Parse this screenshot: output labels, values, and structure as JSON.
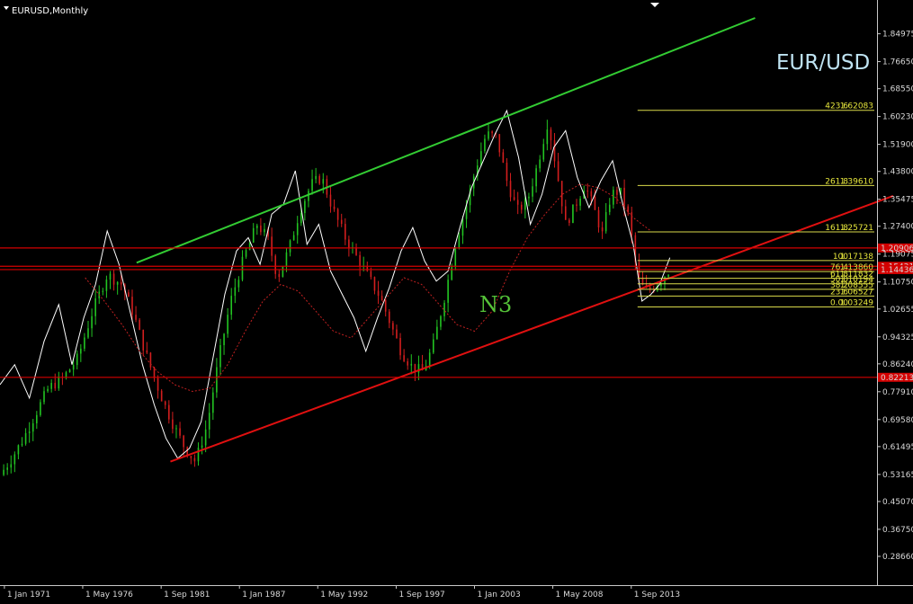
{
  "chart_title": "EURUSD,Monthly",
  "symbol_label": "EUR/USD",
  "wave_label": "N3",
  "colors": {
    "background": "#000000",
    "axis": "#c8c8c8",
    "channel_upper": "#33cc33",
    "channel_lower": "#e01010",
    "fib": "#d9d94a",
    "bull_candle": "#22c422",
    "bear_candle": "#d21e1e",
    "overlay_line": "#ffffff",
    "dotted_line": "#c02020",
    "level_badge": "#d40000"
  },
  "chart_data": {
    "type": "line",
    "ylim": [
      0.2866,
      1.897
    ],
    "y_ticks": [
      "1.84975",
      "1.76650",
      "1.68550",
      "1.60230",
      "1.51900",
      "1.43800",
      "1.35475",
      "1.27400",
      "1.19075",
      "1.10750",
      "1.02655",
      "0.94325",
      "0.86240",
      "0.77910",
      "0.69580",
      "0.61495",
      "0.53165",
      "0.45070",
      "0.36750",
      "0.28660"
    ],
    "x_ticks": [
      "1 Jan 1971",
      "1 May 1976",
      "1 Sep 1981",
      "1 Jan 1987",
      "1 May 1992",
      "1 Sep 1997",
      "1 Jan 2003",
      "1 May 2008",
      "1 Sep 2013"
    ],
    "x_tick_dates": [
      1971.0,
      1976.33,
      1981.67,
      1987.0,
      1992.33,
      1997.67,
      2003.0,
      2008.33,
      2013.67
    ],
    "xlim": [
      1970.7,
      2030.4
    ],
    "series": [
      {
        "values_y": [
          0.53,
          0.58,
          0.64,
          0.72,
          0.79,
          0.82,
          0.88,
          1.02,
          1.13,
          1.1,
          1.01,
          0.91,
          0.82,
          0.74,
          0.67,
          0.61,
          0.57,
          0.68,
          0.88,
          1.05,
          1.18,
          1.28,
          1.24,
          1.12,
          1.21,
          1.32,
          1.4,
          1.42,
          1.32,
          1.24,
          1.18,
          1.12,
          1.06,
          0.98,
          0.9,
          0.85,
          0.84,
          0.92,
          1.07,
          1.22,
          1.33,
          1.45,
          1.55,
          1.54,
          1.41,
          1.32,
          1.35,
          1.46,
          1.59,
          1.44,
          1.28,
          1.33,
          1.4,
          1.33,
          1.25,
          1.37,
          1.38,
          1.3,
          1.12,
          1.08,
          1.09,
          1.11,
          1.13,
          1.15
        ],
        "values_x": [
          1970.7,
          1971.5,
          1972.3,
          1973.2,
          1974.0,
          1975.0,
          1976.0,
          1977.0,
          1978.0,
          1979.0,
          1979.8,
          1980.5,
          1981.2,
          1981.9,
          1982.6,
          1983.3,
          1984.0,
          1984.8,
          1985.6,
          1986.4,
          1987.3,
          1988.2,
          1988.9,
          1989.6,
          1990.4,
          1991.1,
          1991.9,
          1992.6,
          1993.4,
          1994.2,
          1995.0,
          1995.8,
          1996.6,
          1997.3,
          1998.0,
          1998.8,
          1999.5,
          2000.2,
          2001.0,
          2001.7,
          2002.4,
          2003.1,
          2003.8,
          2004.5,
          2005.2,
          2005.9,
          2006.6,
          2007.3,
          2008.0,
          2008.6,
          2009.2,
          2009.8,
          2010.5,
          2011.1,
          2011.7,
          2012.3,
          2012.9,
          2013.5,
          2014.1,
          2014.6,
          2015.1,
          2015.6,
          2016.0,
          2016.4
        ]
      },
      {
        "values_y": [
          0.8,
          0.86,
          0.76,
          0.93,
          1.04,
          0.86,
          1.0,
          1.1,
          1.26,
          1.16,
          1.01,
          0.86,
          0.74,
          0.64,
          0.58,
          0.61,
          0.69,
          0.88,
          1.07,
          1.2,
          1.24,
          1.16,
          1.31,
          1.34,
          1.44,
          1.22,
          1.28,
          1.14,
          1.07,
          1.0,
          0.9,
          1.0,
          1.09,
          1.2,
          1.27,
          1.17,
          1.11,
          1.14,
          1.27,
          1.39,
          1.47,
          1.55,
          1.62,
          1.48,
          1.28,
          1.37,
          1.51,
          1.56,
          1.42,
          1.33,
          1.41,
          1.47,
          1.32,
          1.22,
          1.05,
          1.07,
          1.1,
          1.18
        ],
        "values_x": [
          1970.7,
          1971.7,
          1972.7,
          1973.7,
          1974.7,
          1975.6,
          1976.4,
          1977.2,
          1978.0,
          1978.8,
          1979.6,
          1980.4,
          1981.2,
          1982.0,
          1982.8,
          1983.6,
          1984.4,
          1985.2,
          1986.0,
          1986.8,
          1987.6,
          1988.4,
          1989.2,
          1990.0,
          1990.8,
          1991.6,
          1992.4,
          1993.2,
          1994.0,
          1994.8,
          1995.6,
          1996.4,
          1997.2,
          1998.0,
          1998.8,
          1999.6,
          2000.4,
          2001.2,
          2002.0,
          2002.8,
          2003.6,
          2004.4,
          2005.2,
          2006.0,
          2006.8,
          2007.6,
          2008.4,
          2009.2,
          2010.0,
          2010.8,
          2011.6,
          2012.4,
          2013.2,
          2013.8,
          2014.4,
          2015.0,
          2015.6,
          2016.3
        ]
      },
      {
        "values_y": [
          1.12,
          1.05,
          0.98,
          0.9,
          0.84,
          0.8,
          0.78,
          0.79,
          0.86,
          0.96,
          1.05,
          1.1,
          1.08,
          1.02,
          0.96,
          0.94,
          1.0,
          1.06,
          1.12,
          1.1,
          1.04,
          0.98,
          0.96,
          1.02,
          1.14,
          1.24,
          1.31,
          1.37,
          1.4,
          1.39,
          1.36,
          1.3,
          1.26
        ],
        "values_x": [
          1976.5,
          1977.8,
          1979.0,
          1980.2,
          1981.4,
          1982.6,
          1983.8,
          1985.0,
          1986.2,
          1987.4,
          1988.6,
          1989.8,
          1991.0,
          1992.2,
          1993.4,
          1994.6,
          1995.8,
          1997.0,
          1998.2,
          1999.4,
          2000.6,
          2001.8,
          2003.0,
          2004.2,
          2005.4,
          2006.6,
          2007.8,
          2009.0,
          2010.2,
          2011.4,
          2012.6,
          2013.8,
          2015.0
        ]
      }
    ],
    "channel_lines": [
      {
        "x": [
          1980.0,
          2022.1
        ],
        "y": [
          1.165,
          1.897
        ]
      },
      {
        "x": [
          1982.3,
          2031.5
        ],
        "y": [
          0.57,
          1.365
        ]
      }
    ],
    "horizontal_levels": [
      {
        "y": 1.20906,
        "label": "1.20906"
      },
      {
        "y": 1.15421,
        "label": "1.15421"
      },
      {
        "y": 1.14436,
        "label": "1.14436"
      },
      {
        "y": 0.82213,
        "label": "0.82213"
      }
    ],
    "fibonacci": [
      {
        "level": "423.6",
        "price": "1.62083",
        "y": 1.62083
      },
      {
        "level": "261.8",
        "price": "1.39610",
        "y": 1.3961
      },
      {
        "level": "161.8",
        "price": "1.25721",
        "y": 1.25721
      },
      {
        "level": "100",
        "price": "1.17138",
        "y": 1.17138
      },
      {
        "level": "76.4",
        "price": "1.13860",
        "y": 1.1386
      },
      {
        "level": "61.8",
        "price": "1.11832",
        "y": 1.11832
      },
      {
        "level": "50.0",
        "price": "1.10194",
        "y": 1.10194
      },
      {
        "level": "38.2",
        "price": "1.08555",
        "y": 1.08555
      },
      {
        "level": "23.6",
        "price": "1.06527",
        "y": 1.06527
      },
      {
        "level": "0.00",
        "price": "1.03249",
        "y": 1.03249
      }
    ]
  }
}
